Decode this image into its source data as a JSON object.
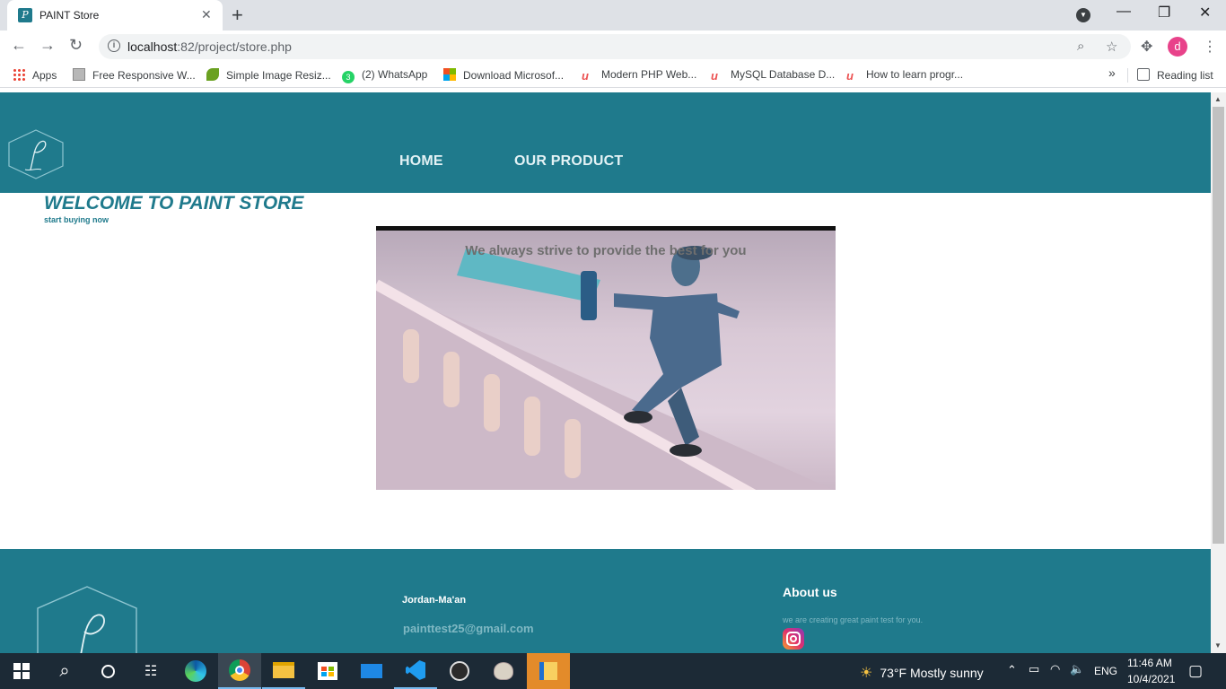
{
  "browser": {
    "tab_title": "PAINT Store",
    "url_host": "localhost",
    "url_rest": ":82/project/store.php",
    "avatar_letter": "d",
    "bookmarks": [
      {
        "label": "Apps",
        "icon": "apps-grid-icon"
      },
      {
        "label": "Free Responsive W...",
        "icon": "page-icon"
      },
      {
        "label": "Simple Image Resiz...",
        "icon": "leaf-icon"
      },
      {
        "label": "(2) WhatsApp",
        "icon": "whatsapp-icon",
        "badge": "3"
      },
      {
        "label": "Download Microsof...",
        "icon": "microsoft-icon"
      },
      {
        "label": "Modern PHP Web...",
        "icon": "udemy-icon"
      },
      {
        "label": "MySQL Database D...",
        "icon": "udemy-icon"
      },
      {
        "label": "How to learn progr...",
        "icon": "udemy-icon"
      }
    ],
    "overflow": "»",
    "reading_list": "Reading list"
  },
  "site": {
    "nav": [
      "HOME",
      "OUR PRODUCT"
    ],
    "welcome_title": "WELCOME TO PAINT STORE",
    "welcome_sub": "start buying now",
    "video_caption": "We always strive to provide the best for you",
    "footer": {
      "name": "Jordan-Ma'an",
      "email": "painttest25@gmail.com",
      "about_title": "About us",
      "about_text": "we are creating great paint test for you."
    },
    "colors": {
      "primary": "#1f7a8c",
      "footer_text": "#7fb8c3"
    }
  },
  "taskbar": {
    "weather": "73°F  Mostly sunny",
    "language": "ENG",
    "time": "11:46 AM",
    "date": "10/4/2021"
  }
}
